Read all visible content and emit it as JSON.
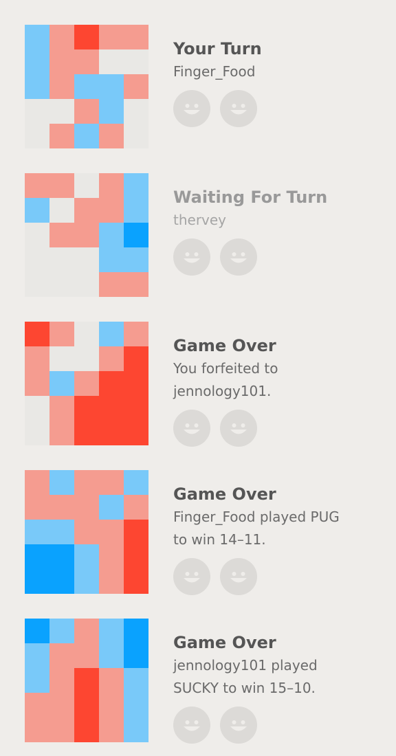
{
  "colors": {
    "L": "#e9e8e5",
    "P": "#f59c90",
    "R": "#fd4631",
    "B": "#79c9f9",
    "D": "#0aa2fe"
  },
  "games": [
    {
      "status": "Your Turn",
      "detail_lines": [
        "Finger_Food"
      ],
      "waiting": false,
      "avatar_icons": [
        "smiley-face-icon",
        "smiley-face-icon"
      ],
      "board": [
        [
          "B",
          "P",
          "R",
          "P",
          "P"
        ],
        [
          "B",
          "P",
          "P",
          "L",
          "L"
        ],
        [
          "B",
          "P",
          "B",
          "B",
          "P"
        ],
        [
          "L",
          "L",
          "P",
          "B",
          "L"
        ],
        [
          "L",
          "P",
          "B",
          "P",
          "L"
        ]
      ]
    },
    {
      "status": "Waiting For Turn",
      "detail_lines": [
        "thervey"
      ],
      "waiting": true,
      "avatar_icons": [
        "smiley-face-icon",
        "smiley-face-icon"
      ],
      "board": [
        [
          "P",
          "P",
          "L",
          "P",
          "B"
        ],
        [
          "B",
          "L",
          "P",
          "P",
          "B"
        ],
        [
          "L",
          "P",
          "P",
          "B",
          "D"
        ],
        [
          "L",
          "L",
          "L",
          "B",
          "B"
        ],
        [
          "L",
          "L",
          "L",
          "P",
          "P"
        ]
      ]
    },
    {
      "status": "Game Over",
      "detail_lines": [
        "You forfeited to",
        "jennology101."
      ],
      "waiting": false,
      "avatar_icons": [
        "smiley-face-icon",
        "smiley-face-icon"
      ],
      "board": [
        [
          "R",
          "P",
          "L",
          "B",
          "P"
        ],
        [
          "P",
          "L",
          "L",
          "P",
          "R"
        ],
        [
          "P",
          "B",
          "P",
          "R",
          "R"
        ],
        [
          "L",
          "P",
          "R",
          "R",
          "R"
        ],
        [
          "L",
          "P",
          "R",
          "R",
          "R"
        ]
      ]
    },
    {
      "status": "Game Over",
      "detail_lines": [
        "Finger_Food played PUG",
        "to win 14–11."
      ],
      "waiting": false,
      "avatar_icons": [
        "smiley-face-icon",
        "smiley-face-icon"
      ],
      "board": [
        [
          "P",
          "B",
          "P",
          "P",
          "B"
        ],
        [
          "P",
          "P",
          "P",
          "B",
          "P"
        ],
        [
          "B",
          "B",
          "P",
          "P",
          "R"
        ],
        [
          "D",
          "D",
          "B",
          "P",
          "R"
        ],
        [
          "D",
          "D",
          "B",
          "P",
          "R"
        ]
      ]
    },
    {
      "status": "Game Over",
      "detail_lines": [
        "jennology101 played",
        "SUCKY to win 15–10."
      ],
      "waiting": false,
      "avatar_icons": [
        "smiley-face-icon",
        "smiley-face-icon"
      ],
      "board": [
        [
          "D",
          "B",
          "P",
          "B",
          "D"
        ],
        [
          "B",
          "P",
          "P",
          "B",
          "D"
        ],
        [
          "B",
          "P",
          "R",
          "P",
          "B"
        ],
        [
          "P",
          "P",
          "R",
          "P",
          "B"
        ],
        [
          "P",
          "P",
          "R",
          "P",
          "B"
        ]
      ]
    }
  ]
}
